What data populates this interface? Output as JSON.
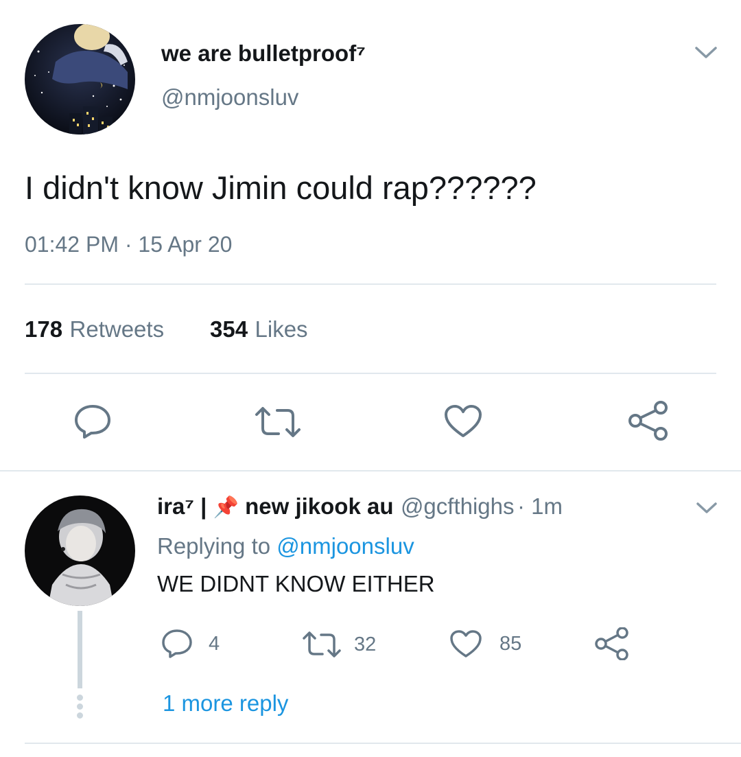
{
  "main_tweet": {
    "display_name": "we are bulletproof⁷",
    "handle": "@nmjoonsluv",
    "text": "I didn't know Jimin could rap??????",
    "timestamp": "01:42 PM · 15 Apr 20",
    "retweets_count": "178",
    "retweets_label": "Retweets",
    "likes_count": "354",
    "likes_label": "Likes",
    "actions": [
      "reply-icon",
      "retweet-icon",
      "like-icon",
      "share-icon"
    ]
  },
  "reply": {
    "display_name_prefix": "ira⁷ | ",
    "pin_emoji": "📌",
    "display_name_suffix": " new jikook au",
    "handle": "@gcfthighs",
    "time": "· 1m",
    "replying_to_label": "Replying to",
    "replying_to_handle": "@nmjoonsluv",
    "text": "WE DIDNT KNOW EITHER",
    "reply_count": "4",
    "retweet_count": "32",
    "like_count": "85",
    "more_replies": "1 more reply"
  },
  "colors": {
    "text_primary": "#14171a",
    "text_secondary": "#657786",
    "link": "#1b95e0",
    "divider": "#e1e8ed",
    "icon": "#657786"
  }
}
